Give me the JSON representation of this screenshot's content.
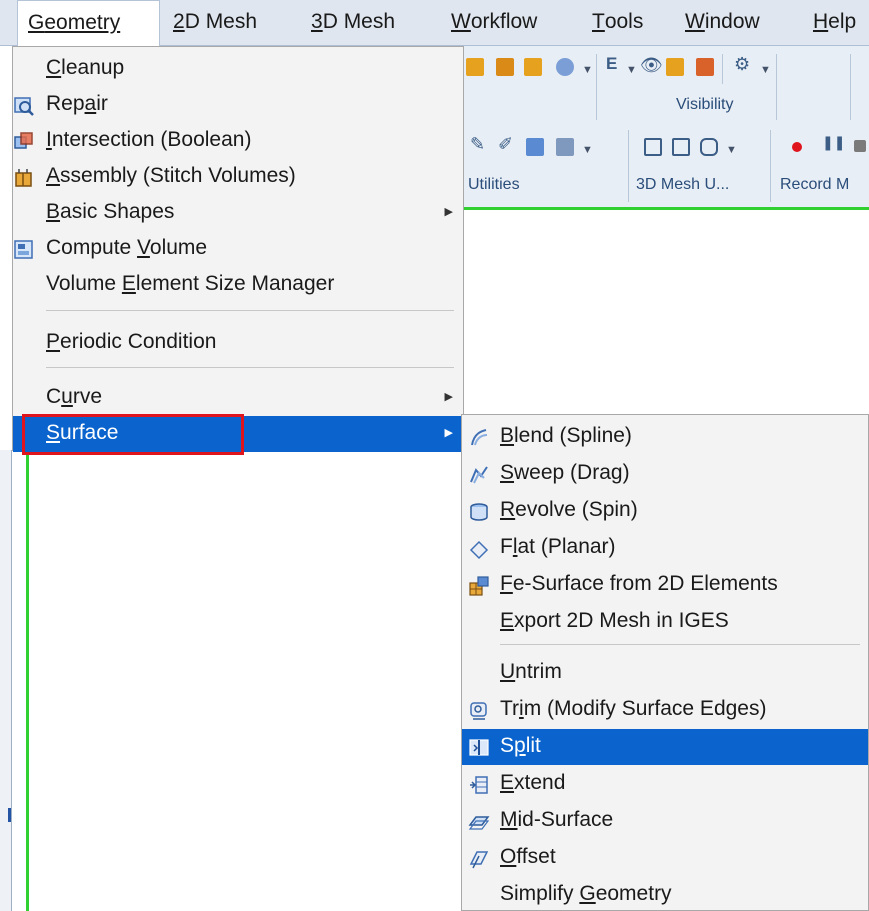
{
  "menubar": {
    "items": [
      {
        "lead": "G",
        "rest": "eometry"
      },
      {
        "lead": "2",
        "rest": "D Mesh"
      },
      {
        "lead": "3",
        "rest": "D Mesh"
      },
      {
        "lead": "W",
        "rest": "orkflow"
      },
      {
        "lead": "T",
        "rest": "ools"
      },
      {
        "lead": "W",
        "rest": "indow"
      },
      {
        "lead": "H",
        "rest": "elp"
      }
    ]
  },
  "ribbon": {
    "visibility_label": "Visibility",
    "utilities_label": "Utilities",
    "mesh3d_utilities_label": "3D Mesh U...",
    "record_label": "Record M"
  },
  "geometry_menu": {
    "items": [
      {
        "pre": "",
        "u": "C",
        "post": "leanup",
        "icon": "none"
      },
      {
        "pre": "Rep",
        "u": "a",
        "post": "ir",
        "icon": "repair-icon"
      },
      {
        "pre": "",
        "u": "I",
        "post": "ntersection (Boolean)",
        "icon": "boolean-icon"
      },
      {
        "pre": "",
        "u": "A",
        "post": "ssembly (Stitch Volumes)",
        "icon": "stitch-icon"
      },
      {
        "pre": "",
        "u": "B",
        "post": "asic Shapes",
        "icon": "none",
        "submenu": true
      },
      {
        "pre": "Compute ",
        "u": "V",
        "post": "olume",
        "icon": "volume-icon"
      },
      {
        "pre": "Volume ",
        "u": "E",
        "post": "lement Size Manager",
        "icon": "none"
      },
      {
        "pre": "",
        "u": "P",
        "post": "eriodic Condition",
        "icon": "none"
      },
      {
        "pre": "C",
        "u": "u",
        "post": "rve",
        "icon": "none",
        "submenu": true
      },
      {
        "pre": "",
        "u": "S",
        "post": "urface",
        "icon": "none",
        "submenu": true,
        "highlighted": true
      }
    ]
  },
  "surface_menu": {
    "items": [
      {
        "pre": "",
        "u": "B",
        "post": "lend (Spline)",
        "icon": "blend-icon"
      },
      {
        "pre": "",
        "u": "S",
        "post": "weep (Drag)",
        "icon": "sweep-icon"
      },
      {
        "pre": "",
        "u": "R",
        "post": "evolve (Spin)",
        "icon": "revolve-icon"
      },
      {
        "pre": "F",
        "u": "l",
        "post": "at (Planar)",
        "icon": "flat-icon"
      },
      {
        "pre": "",
        "u": "F",
        "post": "e-Surface from 2D Elements",
        "icon": "fe-surface-icon"
      },
      {
        "pre": "",
        "u": "E",
        "post": "xport 2D Mesh in IGES",
        "icon": "none"
      },
      {
        "pre": "",
        "u": "U",
        "post": "ntrim",
        "icon": "none"
      },
      {
        "pre": "Tr",
        "u": "i",
        "post": "m (Modify Surface Edges)",
        "icon": "trim-icon"
      },
      {
        "pre": "S",
        "u": "p",
        "post": "lit",
        "icon": "split-icon",
        "highlighted": true
      },
      {
        "pre": "",
        "u": "E",
        "post": "xtend",
        "icon": "extend-icon"
      },
      {
        "pre": "",
        "u": "M",
        "post": "id-Surface",
        "icon": "mid-surface-icon"
      },
      {
        "pre": "",
        "u": "O",
        "post": "ffset",
        "icon": "offset-icon"
      },
      {
        "pre": "Simplify ",
        "u": "G",
        "post": "eometry",
        "icon": "none"
      }
    ]
  },
  "colors": {
    "highlight": "#0b64cd",
    "annotation_box": "#e0141c",
    "viewport_border": "#2fd02f"
  }
}
